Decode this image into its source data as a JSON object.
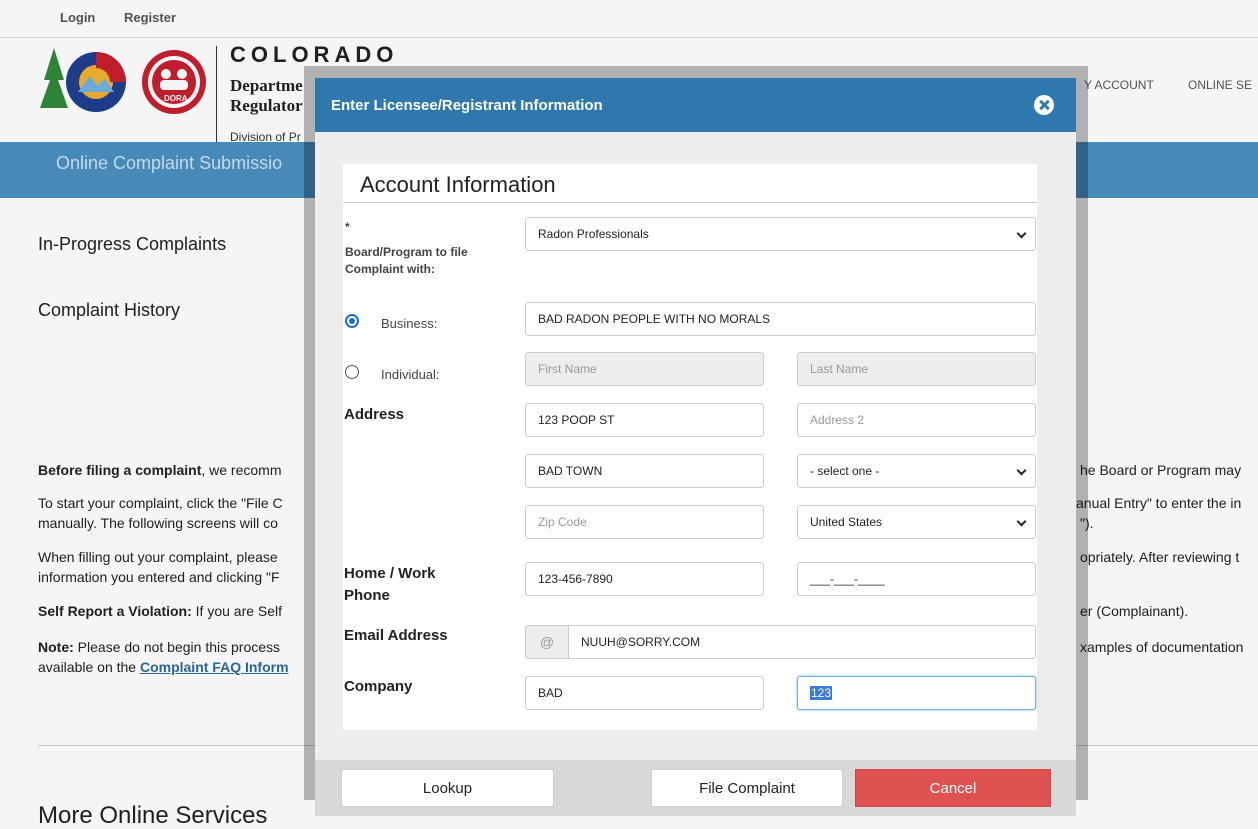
{
  "topbar": {
    "login": "Login",
    "register": "Register"
  },
  "header": {
    "state": "COLORADO",
    "dept_line1": "Departme",
    "dept_line2": "Regulator",
    "division": "Division of Pr",
    "dora_badge": "DORA",
    "nav_my_account": "Y ACCOUNT",
    "nav_online_services": "ONLINE SE"
  },
  "banner": {
    "title": "Online Complaint Submissio"
  },
  "sidebar": {
    "in_progress": "In-Progress Complaints",
    "history": "Complaint History"
  },
  "background_text": {
    "p1_bold": "Before filing a complaint",
    "p1_rest": ", we recomm",
    "p1_right": "he Board or Program may",
    "p2_a": "To start your complaint, click the \"File C",
    "p2_b": "manually. The following screens will co",
    "p2_right_a": "anual Entry\" to enter the in",
    "p2_right_b": "\").",
    "p3_a": "When filling out your complaint, please",
    "p3_b": "information you entered and clicking \"F",
    "p3_right": "opriately. After reviewing t",
    "p4_bold": "Self Report a Violation:",
    "p4_rest": " If you are Self",
    "p4_right": "er (Complainant).",
    "p5_bold": "Note:",
    "p5_rest": " Please do not begin this process",
    "p5_b_text": "available on the ",
    "p5_link": "Complaint FAQ Inform",
    "p5_right": "xamples of documentation",
    "more_online": "More Online Services"
  },
  "modal": {
    "title": "Enter Licensee/Registrant Information",
    "section_title": "Account Information",
    "board": {
      "required_mark": "*",
      "label": "Board/Program to file Complaint with:",
      "value": "Radon Professionals"
    },
    "business": {
      "label": "Business:",
      "value": "BAD RADON PEOPLE WITH NO MORALS",
      "selected": true
    },
    "individual": {
      "label": "Individual:",
      "first_placeholder": "First Name",
      "last_placeholder": "Last Name",
      "selected": false
    },
    "address": {
      "label": "Address",
      "line1": "123 POOP ST",
      "line2_placeholder": "Address 2",
      "city": "BAD TOWN",
      "state": "- select one -",
      "zip_placeholder": "Zip Code",
      "country": "United States"
    },
    "phone": {
      "label_line1": "Home / Work",
      "label_line2": "Phone",
      "value": "123-456-7890",
      "alt_mask": "___-___-____"
    },
    "email": {
      "label": "Email Address",
      "addon": "@",
      "value": "NUUH@SORRY.COM"
    },
    "company": {
      "label": "Company",
      "value": "BAD",
      "value2": "123"
    },
    "buttons": {
      "lookup": "Lookup",
      "file": "File Complaint",
      "cancel": "Cancel"
    }
  }
}
